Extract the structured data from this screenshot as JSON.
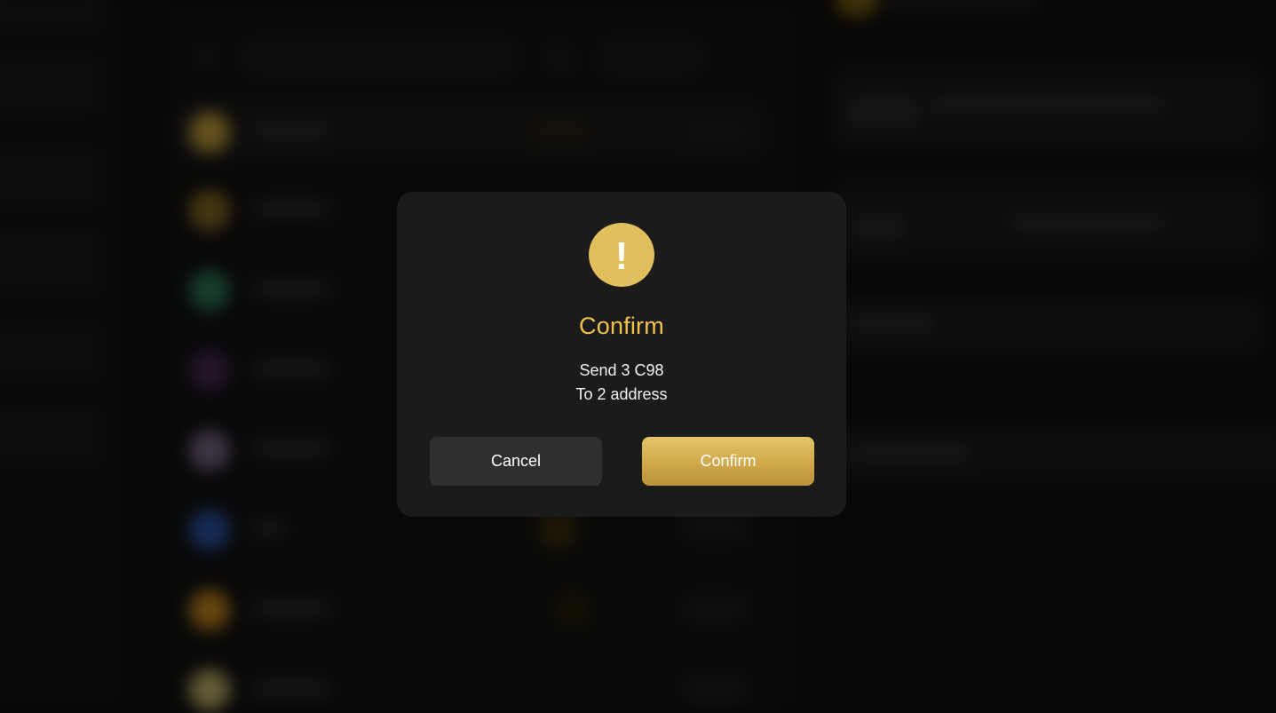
{
  "dialog": {
    "title": "Confirm",
    "message_line1": "Send 3 C98",
    "message_line2": "To 2 address",
    "cancel_label": "Cancel",
    "confirm_label": "Confirm",
    "icon": "warning-exclamation-icon",
    "icon_glyph": "!"
  },
  "colors": {
    "accent_gold": "#efc24e",
    "icon_bg": "#e0bf5d",
    "dialog_bg": "#1b1b1b",
    "cancel_bg": "#2f2f2f"
  }
}
